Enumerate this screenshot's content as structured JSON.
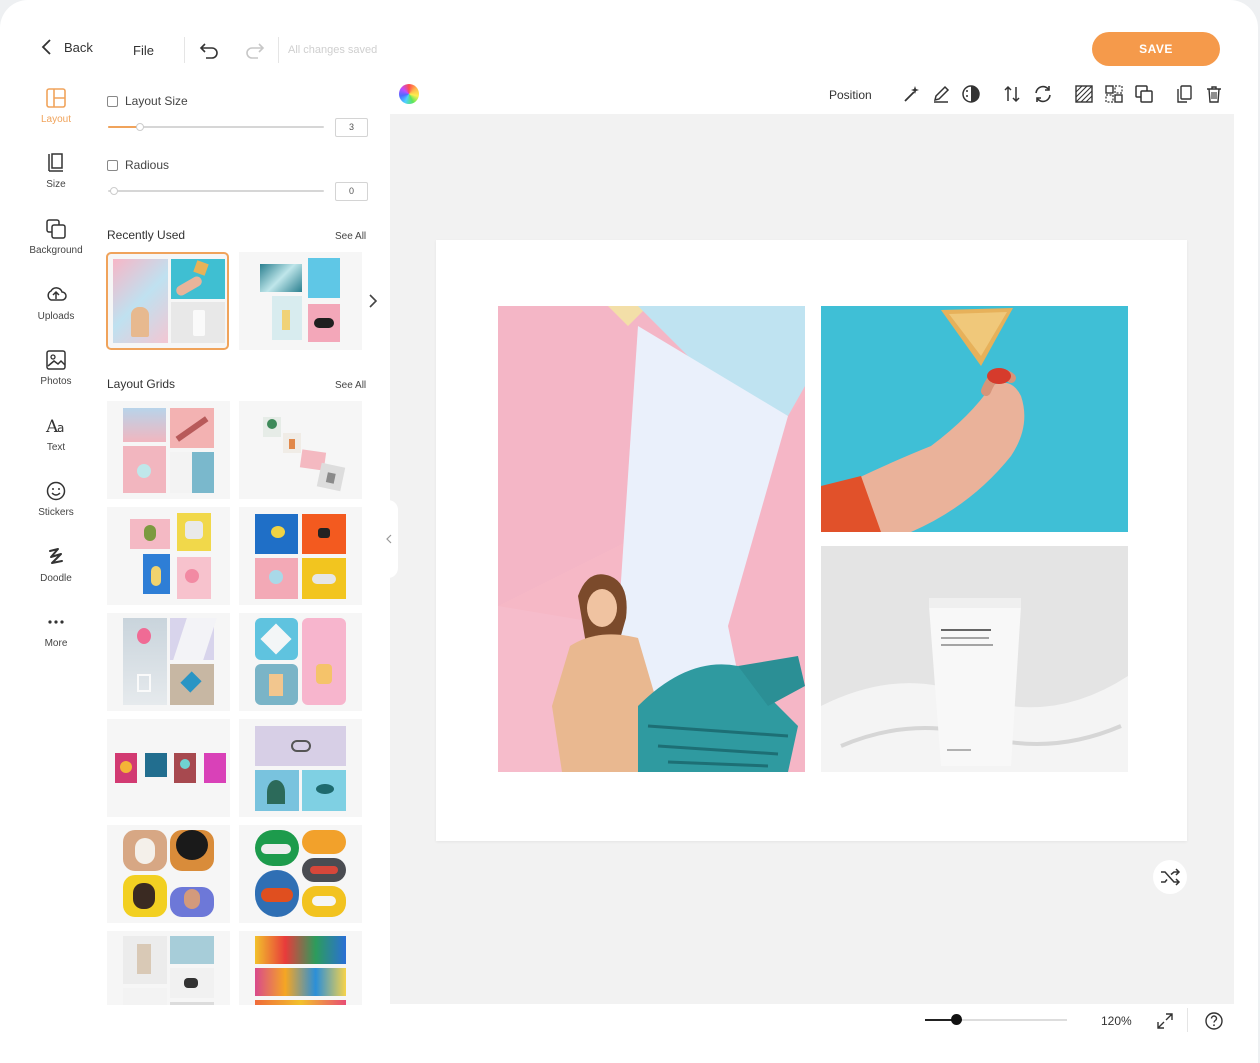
{
  "header": {
    "back_label": "Back",
    "file_label": "File",
    "status": "All changes saved",
    "save_label": "SAVE"
  },
  "rail": {
    "items": [
      {
        "label": "Layout",
        "icon": "layout-icon",
        "active": true
      },
      {
        "label": "Size",
        "icon": "size-icon"
      },
      {
        "label": "Background",
        "icon": "background-icon"
      },
      {
        "label": "Uploads",
        "icon": "upload-icon"
      },
      {
        "label": "Photos",
        "icon": "photo-icon"
      },
      {
        "label": "Text",
        "icon": "text-icon"
      },
      {
        "label": "Stickers",
        "icon": "sticker-icon"
      },
      {
        "label": "Doodle",
        "icon": "doodle-icon"
      },
      {
        "label": "More",
        "icon": "more-icon"
      }
    ]
  },
  "panel": {
    "layout_size_label": "Layout Size",
    "layout_size_value": "3",
    "layout_size_fraction": 0.15,
    "radius_label": "Radious",
    "radius_value": "0",
    "radius_fraction": 0,
    "recently_used_title": "Recently Used",
    "layout_grids_title": "Layout Grids",
    "see_all_label": "See All"
  },
  "toolbar": {
    "position_label": "Position",
    "icons": [
      "magic-wand-icon",
      "pencil-icon",
      "contrast-icon",
      "flip-vertical-icon",
      "rotate-icon",
      "pattern-icon",
      "swap-icon",
      "layers-icon",
      "duplicate-icon",
      "trash-icon"
    ]
  },
  "footer": {
    "zoom_value": "120%",
    "zoom_fraction": 0.22
  },
  "colors": {
    "accent": "#f59a4b",
    "accent_light": "#f0a35b",
    "canvas_bg": "#f2f2f2"
  }
}
